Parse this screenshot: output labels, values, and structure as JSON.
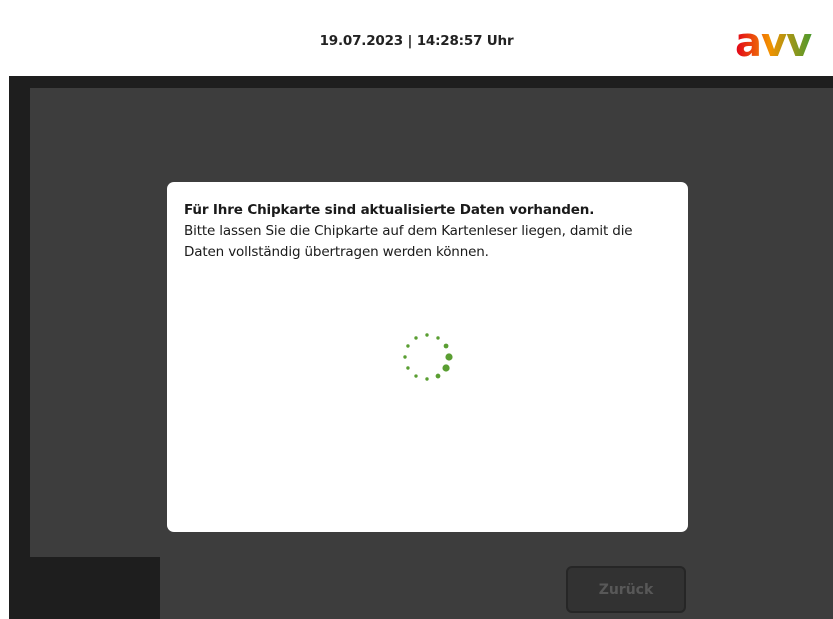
{
  "header": {
    "datetime": "19.07.2023 | 14:28:57 Uhr",
    "logo_text": "avv",
    "logo_colors": [
      "#e2001a",
      "#f39200",
      "#4a9a2f"
    ]
  },
  "dialog": {
    "title": "Für Ihre Chipkarte sind aktualisierte Daten vorhanden.",
    "body": "Bitte lassen Sie die Chipkarte auf dem Kartenleser liegen, damit die Daten vollständig übertragen werden können."
  },
  "spinner": {
    "icon": "loading-spinner-icon",
    "color": "#5a9e32"
  },
  "footer": {
    "back_label": "Zurück"
  },
  "colors": {
    "screen_bg": "#1e1e1e",
    "panel_bg": "#3d3d3d",
    "dialog_bg": "#ffffff"
  }
}
